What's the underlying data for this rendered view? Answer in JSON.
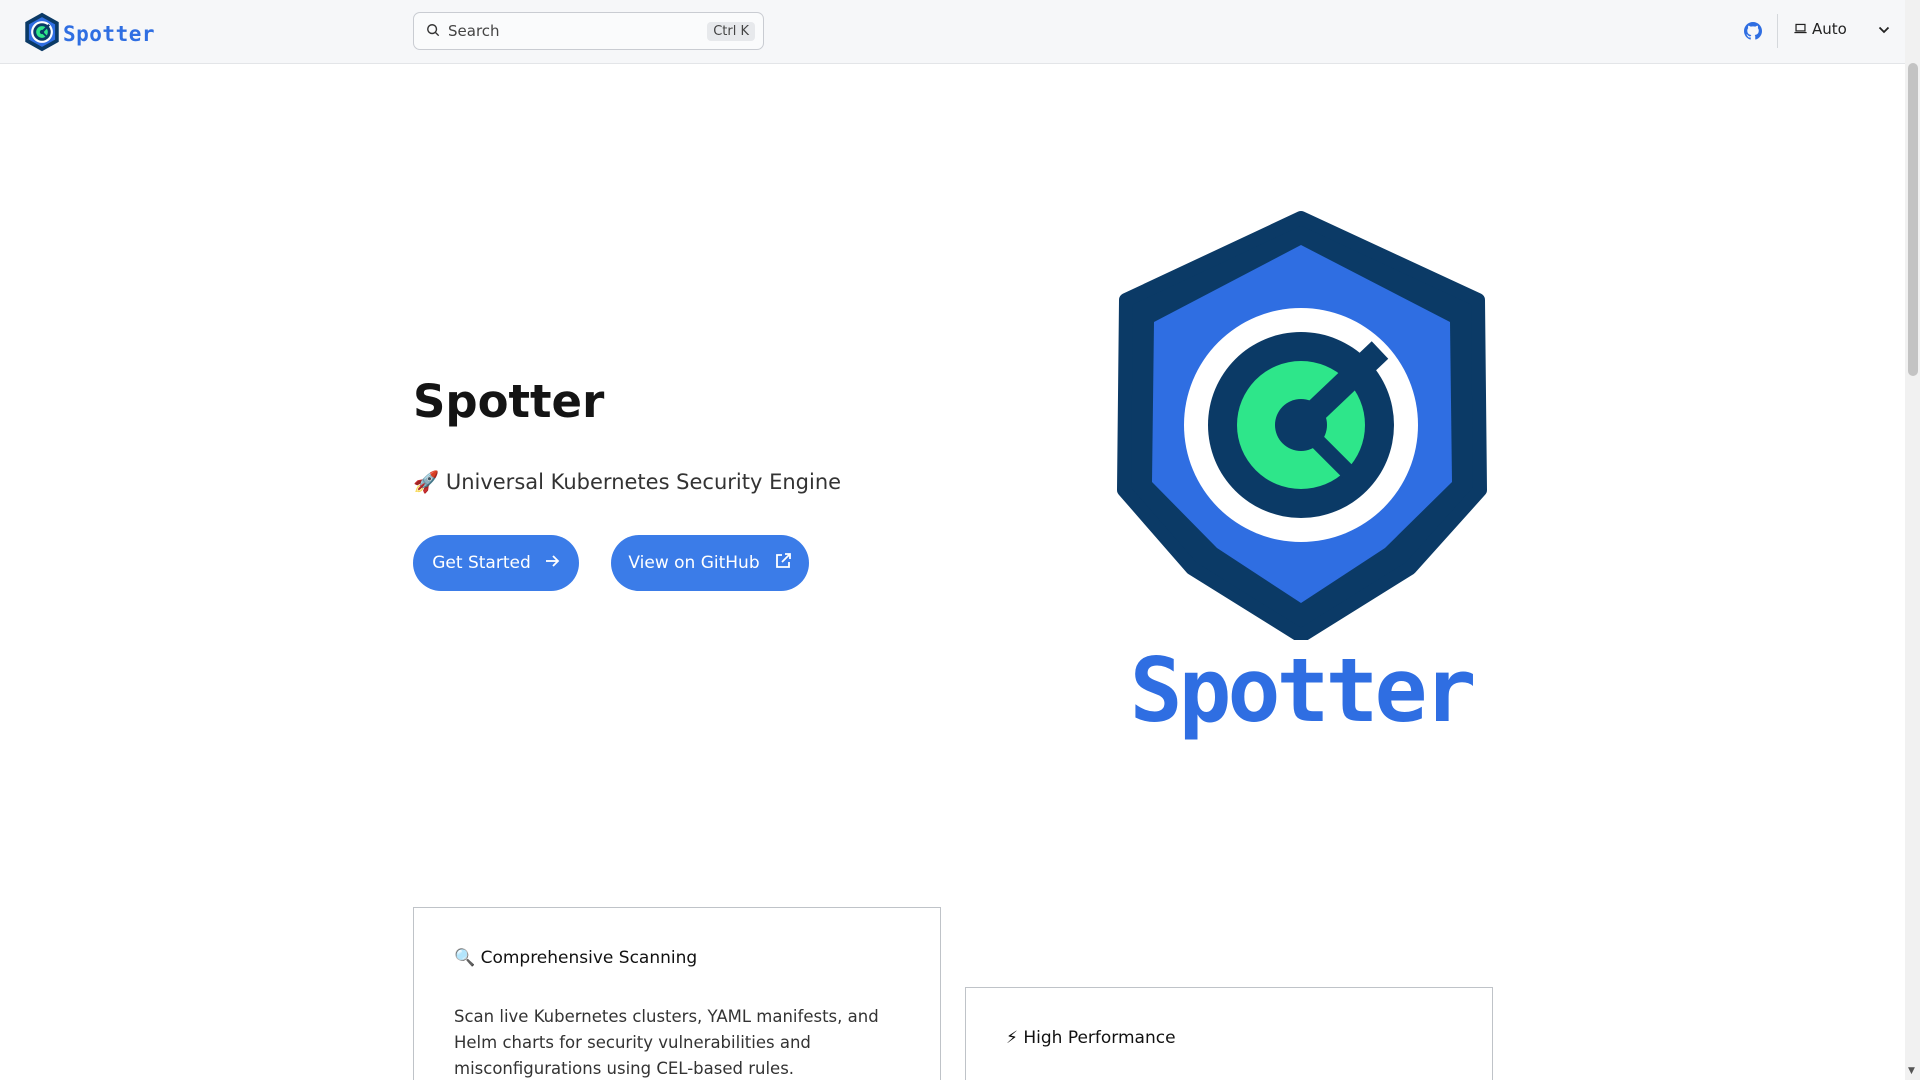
{
  "header": {
    "brand_name": "Spotter",
    "search_placeholder": "Search",
    "search_shortcut": "Ctrl K",
    "theme_label": "Auto"
  },
  "hero": {
    "title": "Spotter",
    "tagline": "🚀 Universal Kubernetes Security Engine",
    "primary_button": "Get Started",
    "secondary_button": "View on GitHub",
    "logo_wordmark": "Spotter"
  },
  "features": [
    {
      "title": "🔍 Comprehensive Scanning",
      "description": "Scan live Kubernetes clusters, YAML manifests, and Helm charts for security vulnerabilities and misconfigurations using CEL-based rules."
    },
    {
      "title": "⚡ High Performance",
      "description": ""
    }
  ],
  "colors": {
    "brand_blue": "#2f6ee2",
    "button_blue": "#3b7ce8",
    "logo_navy": "#0b3a66",
    "logo_green": "#2ee68a"
  },
  "icons": {
    "nav_github": "github-icon",
    "theme": "laptop-icon",
    "search": "search-icon",
    "chevron": "chevron-down-icon",
    "arrow": "arrow-right-icon",
    "external": "external-link-icon"
  }
}
